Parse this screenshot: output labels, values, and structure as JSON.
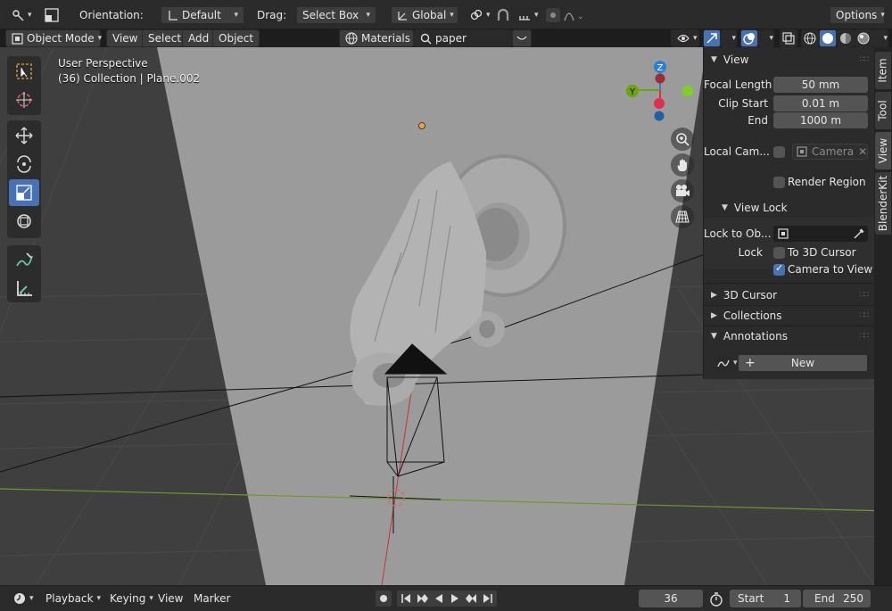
{
  "header": {
    "orientation_label": "Orientation:",
    "orientation_value": "Default",
    "drag_label": "Drag:",
    "drag_value": "Select Box",
    "transform_space": "Global",
    "options_label": "Options"
  },
  "viewport_header": {
    "mode": "Object Mode",
    "menus": [
      "View",
      "Select",
      "Add",
      "Object"
    ],
    "shading_label": "Materials",
    "search_value": "paper"
  },
  "viewport": {
    "perspective": "User Perspective",
    "collection_info": "(36) Collection | Plane.002",
    "gizmo": {
      "z": "Z",
      "y": "Y"
    }
  },
  "npanel": {
    "view_section": "View",
    "focal_length_label": "Focal Length",
    "focal_length_value": "50 mm",
    "clip_start_label": "Clip Start",
    "clip_start_value": "0.01 m",
    "end_label": "End",
    "end_value": "1000 m",
    "local_camera_label": "Local Cam...",
    "local_camera_value": "Camera",
    "render_region_label": "Render Region",
    "view_lock_section": "View Lock",
    "lock_to_object_label": "Lock to Ob...",
    "lock_label": "Lock",
    "to_3d_cursor_label": "To 3D Cursor",
    "camera_to_view_label": "Camera to View",
    "camera_to_view_checked": true,
    "cursor_section": "3D Cursor",
    "collections_section": "Collections",
    "annotations_section": "Annotations",
    "new_button": "New"
  },
  "tabs": [
    "Item",
    "Tool",
    "View",
    "BlenderKit"
  ],
  "active_tab": "View",
  "timeline": {
    "playback": "Playback",
    "keying": "Keying",
    "view": "View",
    "marker": "Marker",
    "current_frame": "36",
    "start_label": "Start",
    "start_value": "1",
    "end_label": "End",
    "end_value": "250"
  },
  "colors": {
    "accent": "#4772b3",
    "panel": "#2b2b2b",
    "viewport": "#3f3f3f",
    "axis_x": "#e0304a",
    "axis_y": "#6da30c",
    "axis_z": "#2a7fd6"
  }
}
